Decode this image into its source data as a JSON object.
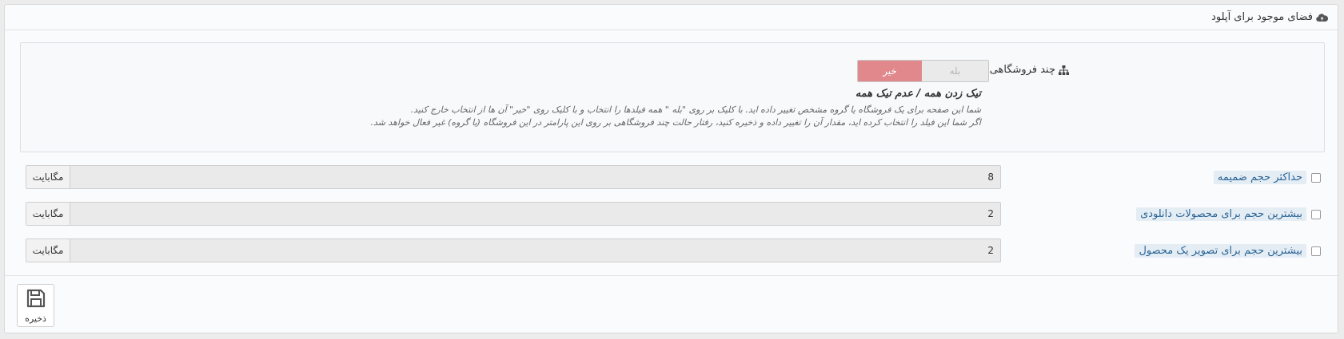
{
  "panel": {
    "title": "فضای موجود برای آپلود",
    "icon": "cloud-upload-icon"
  },
  "multistore": {
    "label": "چند فروشگاهی",
    "icon": "sitemap-icon",
    "toggle": {
      "yes_label": "بله",
      "no_label": "خیر",
      "selected": "خیر"
    },
    "select_all": "تیک زدن همه / عدم تیک همه",
    "help_line1": "شما این صفحه برای یک فروشگاه یا گروه مشخص تغییر داده اید. با کلیک بر روی \"بله \" همه فیلدها را انتخاب و با کلیک روی \"خیر\" آن ها از انتخاب خارج کنید.",
    "help_line2": "اگر شما این فیلد را انتخاب کرده اید، مقدار آن را تغییر داده و ذخیره کنید، رفتار حالت چند فروشگاهی بر روی این پارامتر در این فروشگاه (یا گروه) غیر فعال خواهد شد."
  },
  "fields": [
    {
      "label": "حداکثر حجم ضمیمه",
      "value": "8",
      "unit": "مگابایت"
    },
    {
      "label": "بیشترین حجم برای محصولات دانلودی",
      "value": "2",
      "unit": "مگابایت"
    },
    {
      "label": "بیشترین حجم برای تصویر یک محصول",
      "value": "2",
      "unit": "مگابایت"
    }
  ],
  "footer": {
    "save_label": "ذخیره",
    "save_icon": "save-icon"
  }
}
